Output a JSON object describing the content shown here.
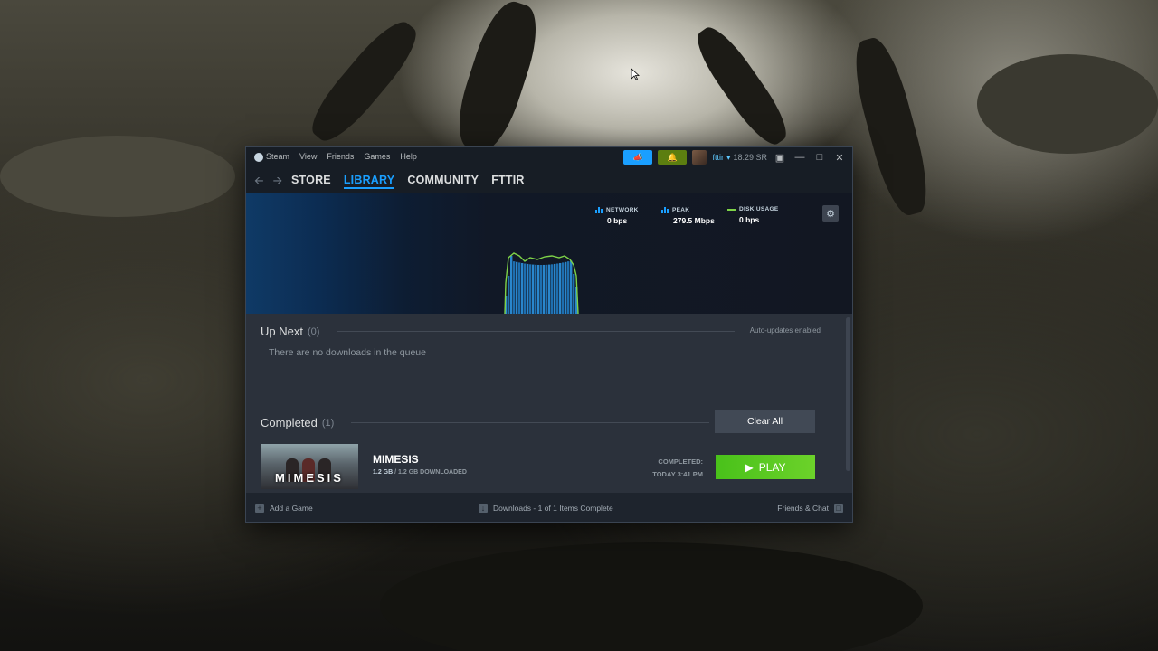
{
  "menu": {
    "items": [
      "Steam",
      "View",
      "Friends",
      "Games",
      "Help"
    ]
  },
  "user": {
    "name": "fttir",
    "balance": "18.29 SR"
  },
  "nav": {
    "tabs": [
      "STORE",
      "LIBRARY",
      "COMMUNITY",
      "FTTIR"
    ],
    "active": "LIBRARY"
  },
  "stats": {
    "network": {
      "label": "NETWORK",
      "value": "0 bps"
    },
    "peak": {
      "label": "PEAK",
      "value": "279.5 Mbps"
    },
    "disk": {
      "label": "DISK USAGE",
      "value": "0 bps"
    }
  },
  "up_next": {
    "title": "Up Next",
    "count": "(0)",
    "auto_updates": "Auto-updates enabled",
    "empty_message": "There are no downloads in the queue"
  },
  "completed": {
    "title": "Completed",
    "count": "(1)",
    "clear_all": "Clear All",
    "game": {
      "name": "MIMESIS",
      "art_title": "MIMESIS",
      "size_done": "1.2 GB",
      "size_total": "/ 1.2 GB DOWNLOADED",
      "status_line1": "COMPLETED:",
      "status_line2": "TODAY 3:41 PM",
      "play_label": "PLAY"
    }
  },
  "footer": {
    "add_game": "Add a Game",
    "downloads_status": "Downloads - 1 of 1 Items Complete",
    "friends_chat": "Friends & Chat"
  },
  "colors": {
    "accent": "#1a9fff",
    "play_green": "#5ba32b",
    "disk_line": "#7ed348"
  }
}
